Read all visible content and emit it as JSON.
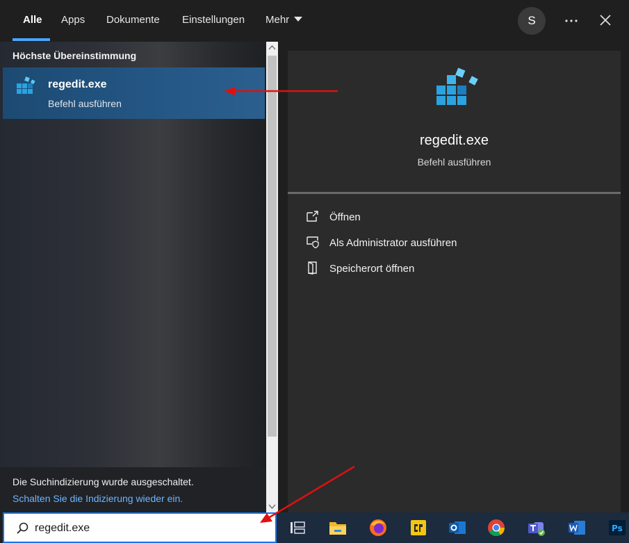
{
  "tabs": {
    "all": "Alle",
    "apps": "Apps",
    "documents": "Dokumente",
    "settings": "Einstellungen",
    "more": "Mehr"
  },
  "avatar_letter": "S",
  "best_match": {
    "section_label": "Höchste Übereinstimmung",
    "title": "regedit.exe",
    "subtitle": "Befehl ausführen",
    "icon": "registry-editor-icon"
  },
  "detail": {
    "title": "regedit.exe",
    "subtitle": "Befehl ausführen",
    "actions": [
      {
        "label": "Öffnen",
        "icon": "open-icon"
      },
      {
        "label": "Als Administrator ausführen",
        "icon": "admin-shield-icon"
      },
      {
        "label": "Speicherort öffnen",
        "icon": "file-location-icon"
      }
    ]
  },
  "indexing": {
    "message": "Die Suchindizierung wurde ausgeschaltet.",
    "link": "Schalten Sie die Indizierung wieder ein."
  },
  "search": {
    "value": "regedit.exe"
  },
  "taskbar_icons": [
    "task-view-icon",
    "file-explorer-icon",
    "firefox-icon",
    "cr-app-icon",
    "outlook-icon",
    "chrome-icon",
    "teams-icon",
    "word-icon",
    "photoshop-icon"
  ],
  "colors": {
    "accent": "#4aa6ff",
    "selection": "#245684",
    "annotation_arrow": "#e01010"
  }
}
